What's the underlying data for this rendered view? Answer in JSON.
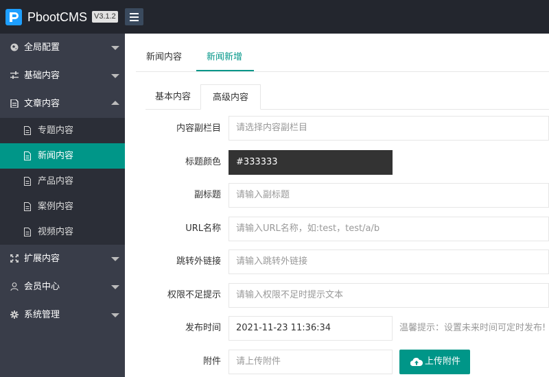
{
  "header": {
    "brand": "PbootCMS",
    "version": "V3.1.2"
  },
  "sidebar": {
    "items": [
      {
        "label": "全局配置",
        "icon": "globe-icon"
      },
      {
        "label": "基础内容",
        "icon": "sliders-icon"
      },
      {
        "label": "文章内容",
        "icon": "file-icon"
      },
      {
        "label": "扩展内容",
        "icon": "expand-icon"
      },
      {
        "label": "会员中心",
        "icon": "user-icon"
      },
      {
        "label": "系统管理",
        "icon": "gear-icon"
      }
    ],
    "subitems": [
      {
        "label": "专题内容"
      },
      {
        "label": "新闻内容"
      },
      {
        "label": "产品内容"
      },
      {
        "label": "案例内容"
      },
      {
        "label": "视频内容"
      }
    ]
  },
  "tabs": [
    {
      "label": "新闻内容"
    },
    {
      "label": "新闻新增"
    }
  ],
  "card_tabs": [
    {
      "label": "基本内容"
    },
    {
      "label": "高级内容"
    }
  ],
  "form": {
    "subcolumn": {
      "label": "内容副栏目",
      "placeholder": "请选择内容副栏目"
    },
    "title_color": {
      "label": "标题颜色",
      "value": "#333333"
    },
    "subtitle": {
      "label": "副标题",
      "placeholder": "请输入副标题"
    },
    "url": {
      "label": "URL名称",
      "placeholder": "请输入URL名称，如:test，test/a/b"
    },
    "outlink": {
      "label": "跳转外链接",
      "placeholder": "请输入跳转外链接"
    },
    "permission": {
      "label": "权限不足提示",
      "placeholder": "请输入权限不足时提示文本"
    },
    "publish_time": {
      "label": "发布时间",
      "value": "2021-11-23 11:36:34",
      "hint": "温馨提示：设置未来时间可定时发布!"
    },
    "attachment": {
      "label": "附件",
      "placeholder": "请上传附件",
      "button": "上传附件"
    }
  },
  "colors": {
    "accent": "#009688",
    "topbar": "#23262e",
    "sidebar": "#393d49",
    "sidebar_sub": "#2b2e37"
  }
}
